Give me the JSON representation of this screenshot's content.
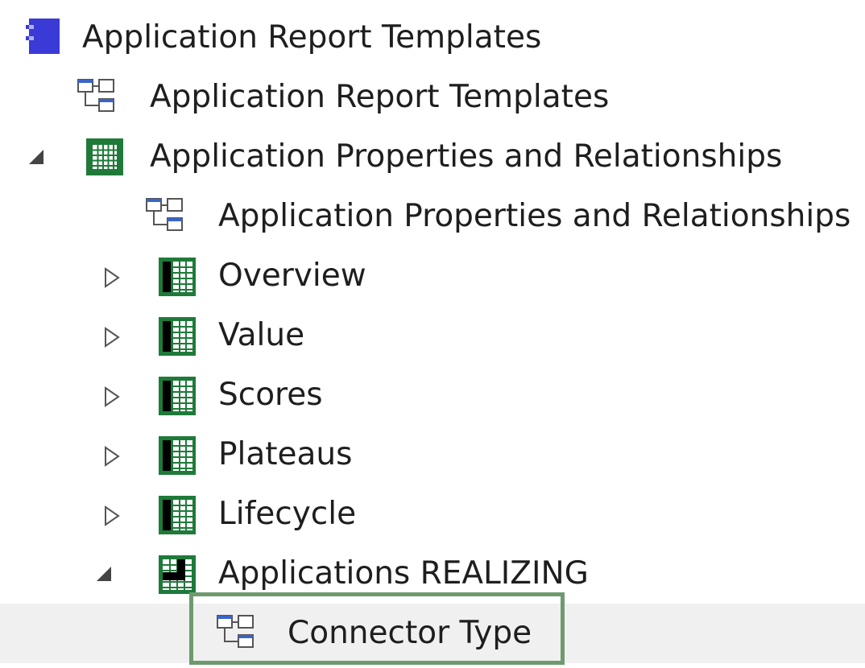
{
  "tree": {
    "items": [
      {
        "label": "Application Report Templates",
        "icon": "package-icon",
        "toggle": "none"
      },
      {
        "label": "Application Report Templates",
        "icon": "diagram-icon",
        "toggle": "none"
      },
      {
        "label": "Application Properties and Relationships",
        "icon": "table-grid-icon",
        "toggle": "expanded"
      },
      {
        "label": "Application Properties and Relationships",
        "icon": "diagram-icon",
        "toggle": "none"
      },
      {
        "label": "Overview",
        "icon": "matrix-icon",
        "toggle": "collapsed"
      },
      {
        "label": "Value",
        "icon": "matrix-icon",
        "toggle": "collapsed"
      },
      {
        "label": "Scores",
        "icon": "matrix-icon",
        "toggle": "collapsed"
      },
      {
        "label": "Plateaus",
        "icon": "matrix-icon",
        "toggle": "collapsed"
      },
      {
        "label": "Lifecycle",
        "icon": "matrix-icon",
        "toggle": "collapsed"
      },
      {
        "label": "Applications REALIZING",
        "icon": "relationship-matrix-icon",
        "toggle": "expanded"
      },
      {
        "label": "Connector Type",
        "icon": "diagram-icon",
        "toggle": "none",
        "selected": true
      }
    ]
  },
  "colors": {
    "package": "#3a3ad6",
    "grid_green": "#1f7a3a",
    "diagram_blue": "#3a64c8",
    "highlight_border": "#6e9a6e",
    "selected_row": "#f0f0f0"
  }
}
